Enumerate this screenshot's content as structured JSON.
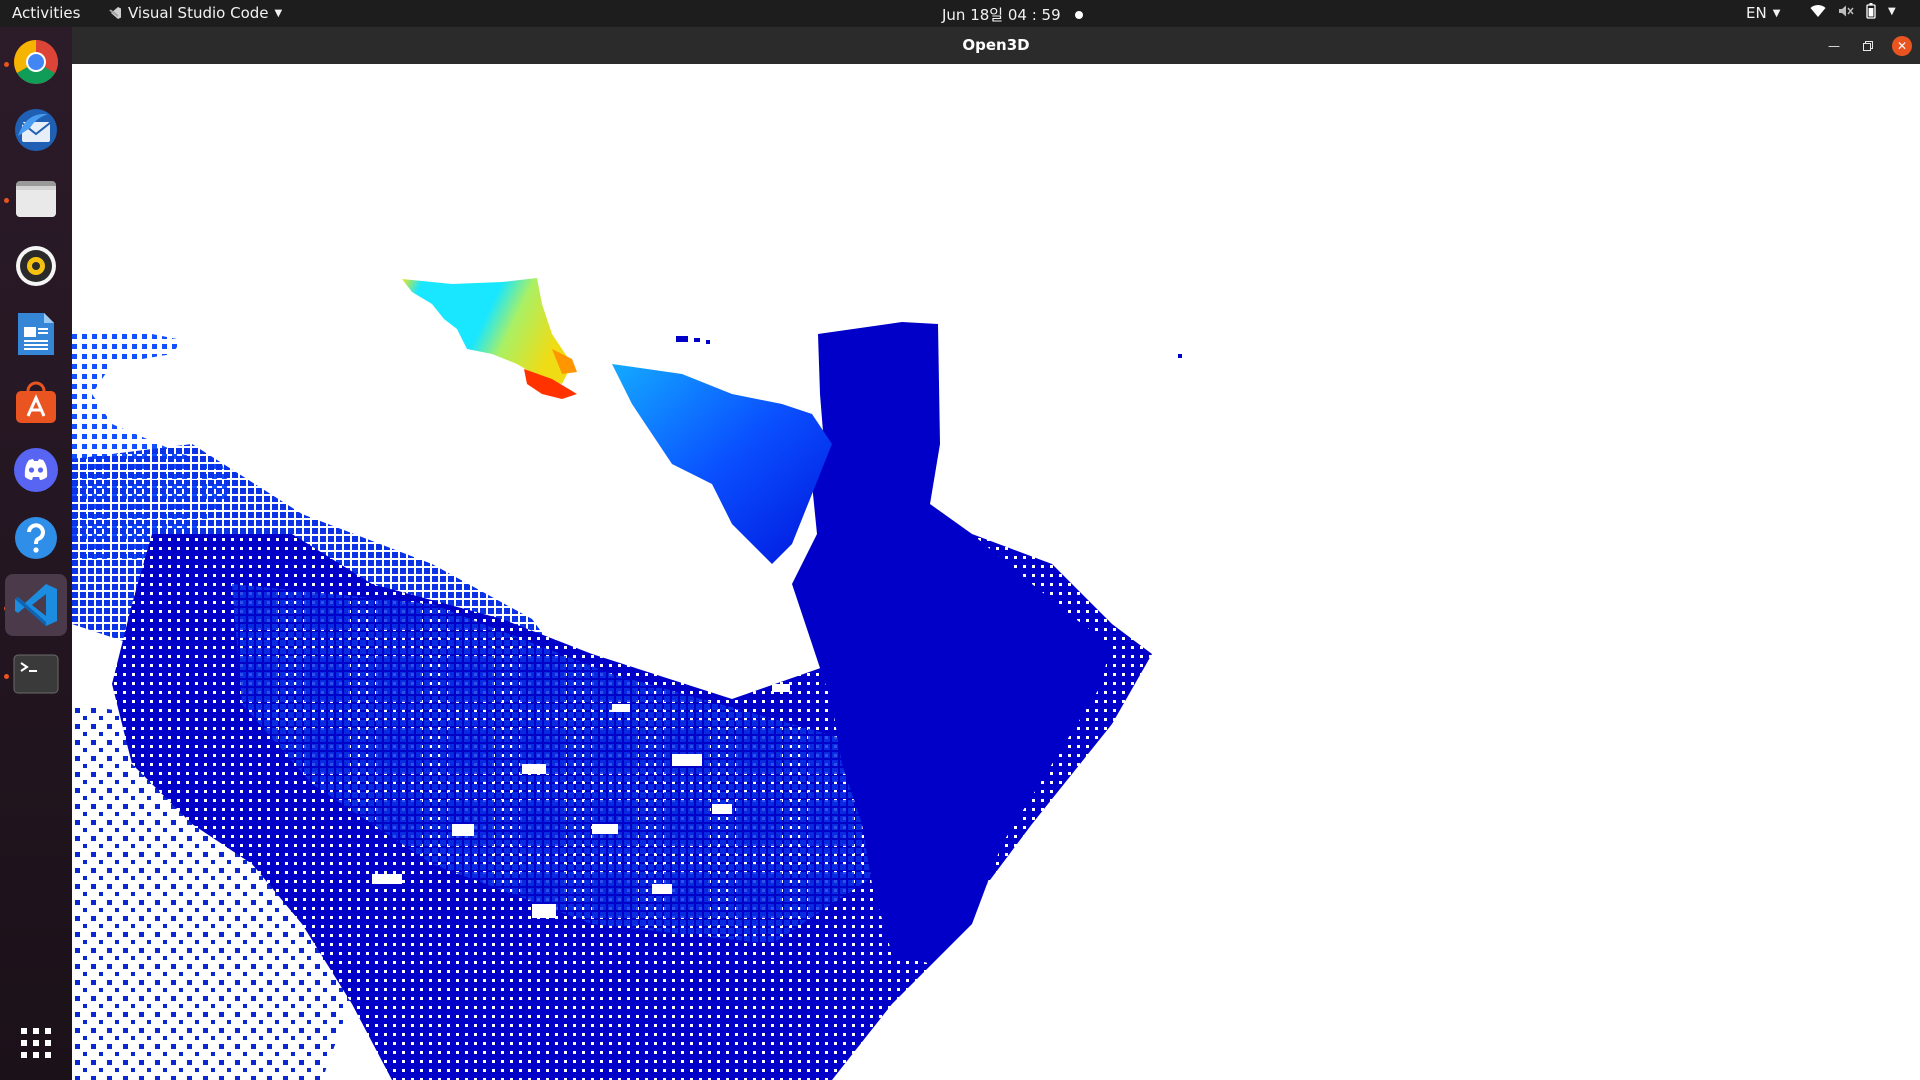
{
  "topbar": {
    "activities": "Activities",
    "app_name": "Visual Studio Code",
    "clock": "Jun 18일  04 : 59",
    "language": "EN"
  },
  "dock": {
    "apps": [
      {
        "name": "chrome",
        "icon": "chrome-icon",
        "running": true
      },
      {
        "name": "thunderbird",
        "icon": "thunderbird-icon",
        "running": false
      },
      {
        "name": "files",
        "icon": "files-icon",
        "running": true
      },
      {
        "name": "rhythmbox",
        "icon": "rhythmbox-icon",
        "running": false
      },
      {
        "name": "writer",
        "icon": "writer-icon",
        "running": false
      },
      {
        "name": "software",
        "icon": "software-icon",
        "running": false
      },
      {
        "name": "discord",
        "icon": "discord-icon",
        "running": false
      },
      {
        "name": "help",
        "icon": "help-icon",
        "running": false
      },
      {
        "name": "vscode",
        "icon": "vscode-icon",
        "running": true
      },
      {
        "name": "terminal",
        "icon": "terminal-icon",
        "running": true
      }
    ]
  },
  "window": {
    "title": "Open3D"
  },
  "colors": {
    "accent": "#e95420",
    "point_dark_blue": "#0000c8",
    "point_blue": "#0a3cff",
    "point_cyan": "#19e6ff",
    "point_yellow": "#f0e619",
    "point_red": "#ff3200"
  }
}
